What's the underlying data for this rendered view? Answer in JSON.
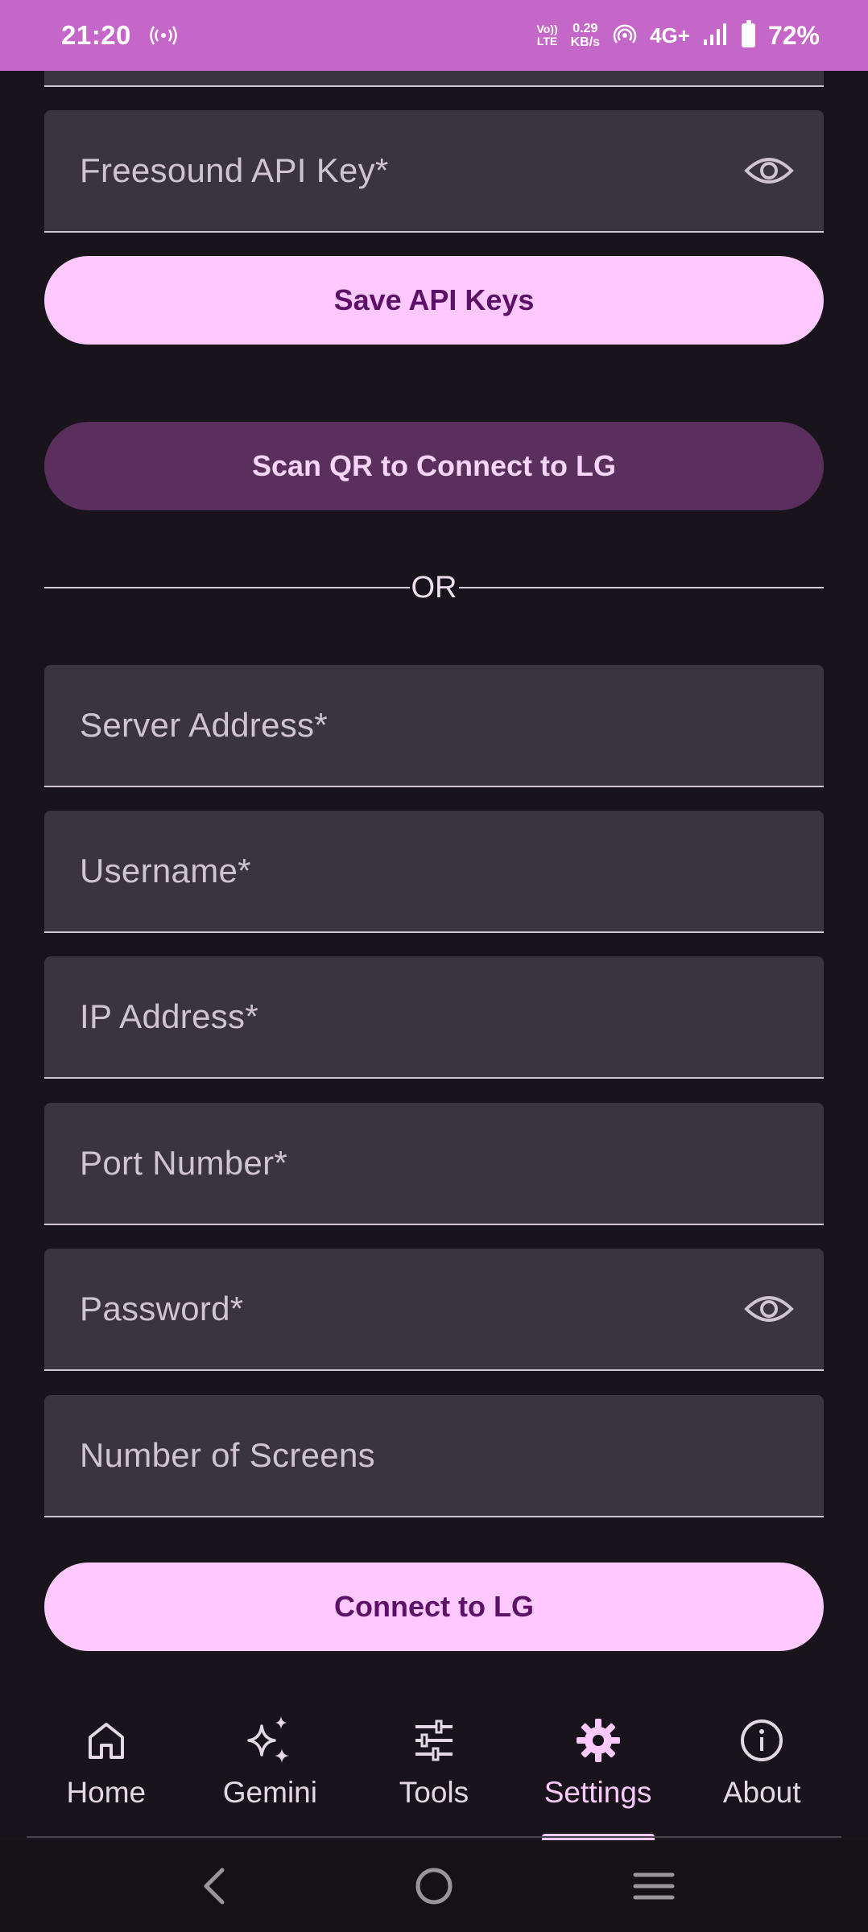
{
  "status_bar": {
    "time": "21:20",
    "volte_top": "Vo))",
    "volte_bottom": "LTE",
    "net_speed_value": "0.29",
    "net_speed_unit": "KB/s",
    "network_type": "4G+",
    "battery_percent": "72%",
    "battery_level": 0.72
  },
  "api_section": {
    "freesound_label": "Freesound API Key*",
    "save_button": "Save API Keys"
  },
  "connection": {
    "scan_button": "Scan QR to Connect to LG",
    "or_text": "OR",
    "fields": {
      "server_address": "Server Address*",
      "username": "Username*",
      "ip_address": "IP Address*",
      "port_number": "Port Number*",
      "password": "Password*",
      "screens": "Number of Screens"
    },
    "connect_button": "Connect to LG"
  },
  "bottom_nav": {
    "items": [
      {
        "label": "Home",
        "icon": "home-icon"
      },
      {
        "label": "Gemini",
        "icon": "sparkle-icon"
      },
      {
        "label": "Tools",
        "icon": "sliders-icon"
      },
      {
        "label": "Settings",
        "icon": "gear-icon",
        "active": true
      },
      {
        "label": "About",
        "icon": "info-icon"
      }
    ]
  },
  "colors": {
    "status_bar": "#c566c9",
    "background": "#19141b",
    "field_bg": "#3a343c",
    "primary_button": "#fdc9ff",
    "secondary_button": "#5a2f5e"
  }
}
